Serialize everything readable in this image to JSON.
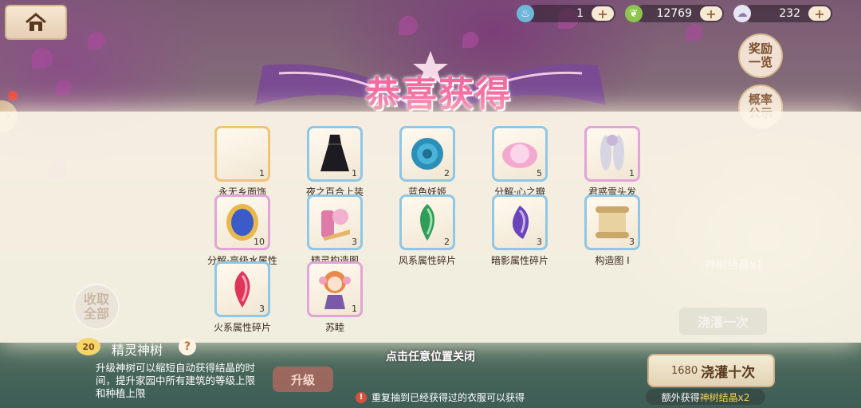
{
  "topbar": {
    "home_icon": "house-icon",
    "resources": [
      {
        "icon": "bath-ticket-icon",
        "value": "1",
        "plus": "+"
      },
      {
        "icon": "leaf-icon",
        "value": "12769",
        "plus": "+"
      },
      {
        "icon": "cloud-sheep-icon",
        "value": "232",
        "plus": "+"
      }
    ]
  },
  "side_buttons": {
    "rewards_preview": "奖励一览",
    "probability": "概率公示",
    "collect_all": "收取全部"
  },
  "banner": {
    "title": "恭喜获得"
  },
  "rewards": [
    {
      "name": "永无乡面饰",
      "count": "1",
      "quality": "gold",
      "icon": "face-accessory-icon"
    },
    {
      "name": "夜之百合上装",
      "count": "1",
      "quality": "blue",
      "icon": "dark-dress-icon"
    },
    {
      "name": "蓝色妖姬",
      "count": "2",
      "quality": "blue",
      "icon": "blue-rose-icon"
    },
    {
      "name": "分解·心之瓣",
      "count": "5",
      "quality": "blue",
      "icon": "heart-petal-icon"
    },
    {
      "name": "君惑雪头发",
      "count": "1",
      "quality": "pink",
      "icon": "white-hair-icon"
    },
    {
      "name": "分解·高级水属性",
      "count": "10",
      "quality": "pink",
      "icon": "water-gem-icon"
    },
    {
      "name": "精灵构造图",
      "count": "3",
      "quality": "blue",
      "icon": "blueprint-scroll-icon"
    },
    {
      "name": "风系属性碎片",
      "count": "2",
      "quality": "blue",
      "icon": "green-shard-icon"
    },
    {
      "name": "暗影属性碎片",
      "count": "3",
      "quality": "blue",
      "icon": "purple-shard-icon"
    },
    {
      "name": "构造图 Ⅰ",
      "count": "3",
      "quality": "blue",
      "icon": "paper-scroll-icon"
    },
    {
      "name": "火系属性碎片",
      "count": "3",
      "quality": "blue",
      "icon": "red-shard-icon"
    },
    {
      "name": "苏睦",
      "count": "1",
      "quality": "pink",
      "icon": "chibi-girl-icon"
    }
  ],
  "close_hint": "点击任意位置关闭",
  "tree": {
    "level": "20",
    "title": "精灵神树",
    "help": "?",
    "description": "升级神树可以缩短自动获得结晶的时间，提升家园中所有建筑的等级上限和种植上限",
    "upgrade_label": "升级"
  },
  "repeat_note": "重复抽到已经获得过的衣服可以获得",
  "water": {
    "ghost_label": "神树结晶x1",
    "once_label": "浇灌一次",
    "ten_cost": "1680",
    "ten_label": "浇灌十次",
    "extra_prefix": "额外获得",
    "extra_item": "神树结晶x2"
  },
  "colors": {
    "title_pink": "#f26aa0",
    "gold_frame": "#f0c474",
    "blue_frame": "#8fc7e6",
    "pink_frame": "#e2a4d9"
  }
}
